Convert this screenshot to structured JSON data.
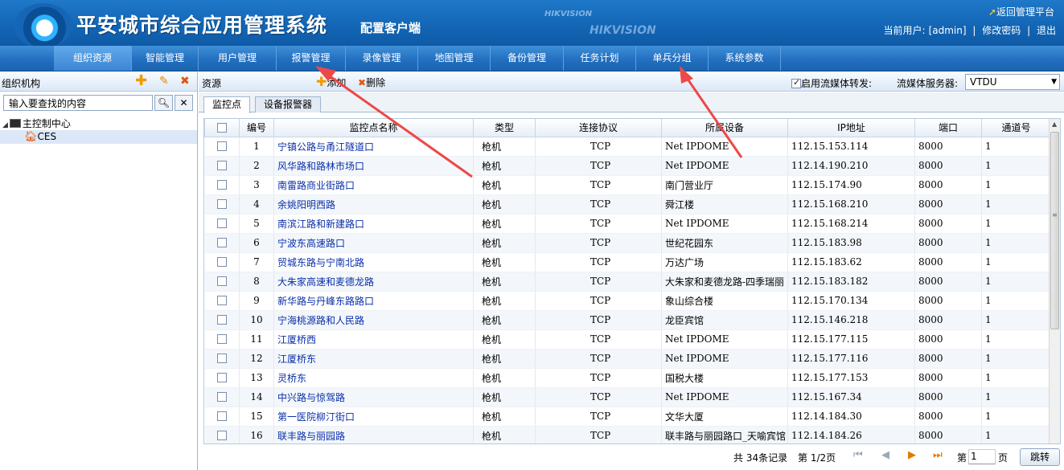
{
  "header": {
    "title": "平安城市综合应用管理系统",
    "subtitle": "配置客户端",
    "brand_small": "HIKVISION",
    "brand_large": "HIKVISION",
    "return_link": "返回管理平台",
    "user_label": "当前用户:",
    "user_name": "[admin]",
    "sep": "|",
    "change_password": "修改密码",
    "logout": "退出"
  },
  "nav": {
    "items": [
      {
        "label": "组织资源"
      },
      {
        "label": "智能管理"
      },
      {
        "label": "用户管理"
      },
      {
        "label": "报警管理"
      },
      {
        "label": "录像管理"
      },
      {
        "label": "地图管理"
      },
      {
        "label": "备份管理"
      },
      {
        "label": "任务计划"
      },
      {
        "label": "单兵分组"
      },
      {
        "label": "系统参数"
      }
    ]
  },
  "left": {
    "title": "组织机构",
    "search_placeholder": "输入要查找的内容",
    "tree": {
      "root": "主控制中心",
      "child": "CES"
    }
  },
  "resources": {
    "title": "资源",
    "add_label": "添加",
    "delete_label": "删除",
    "forward_label": "启用流媒体转发:",
    "server_label": "流媒体服务器:",
    "server_value": "VTDU",
    "tabs": [
      "监控点",
      "设备报警器"
    ]
  },
  "table": {
    "columns": [
      "编号",
      "监控点名称",
      "类型",
      "连接协议",
      "所属设备",
      "IP地址",
      "端口",
      "通道号"
    ],
    "rows": [
      [
        "1",
        "宁镇公路与甬江隧道口",
        "枪机",
        "TCP",
        "Net IPDOME",
        "112.15.153.114",
        "8000",
        "1"
      ],
      [
        "2",
        "风华路和路林市场口",
        "枪机",
        "TCP",
        "Net IPDOME",
        "112.14.190.210",
        "8000",
        "1"
      ],
      [
        "3",
        "南雷路商业街路口",
        "枪机",
        "TCP",
        "南门营业厅",
        "112.15.174.90",
        "8000",
        "1"
      ],
      [
        "4",
        "余姚阳明西路",
        "枪机",
        "TCP",
        "舜江楼",
        "112.15.168.210",
        "8000",
        "1"
      ],
      [
        "5",
        "南滨江路和新建路口",
        "枪机",
        "TCP",
        "Net IPDOME",
        "112.15.168.214",
        "8000",
        "1"
      ],
      [
        "6",
        "宁波东高速路口",
        "枪机",
        "TCP",
        "世纪花园东",
        "112.15.183.98",
        "8000",
        "1"
      ],
      [
        "7",
        "贸城东路与宁南北路",
        "枪机",
        "TCP",
        "万达广场",
        "112.15.183.62",
        "8000",
        "1"
      ],
      [
        "8",
        "大朱家高速和麦德龙路",
        "枪机",
        "TCP",
        "大朱家和麦德龙路-四季瑞丽",
        "112.15.183.182",
        "8000",
        "1"
      ],
      [
        "9",
        "新华路与丹峰东路路口",
        "枪机",
        "TCP",
        "象山综合楼",
        "112.15.170.134",
        "8000",
        "1"
      ],
      [
        "10",
        "宁海桃源路和人民路",
        "枪机",
        "TCP",
        "龙臣宾馆",
        "112.15.146.218",
        "8000",
        "1"
      ],
      [
        "11",
        "江厦桥西",
        "枪机",
        "TCP",
        "Net IPDOME",
        "112.15.177.115",
        "8000",
        "1"
      ],
      [
        "12",
        "江厦桥东",
        "枪机",
        "TCP",
        "Net IPDOME",
        "112.15.177.116",
        "8000",
        "1"
      ],
      [
        "13",
        "灵桥东",
        "枪机",
        "TCP",
        "国税大楼",
        "112.15.177.153",
        "8000",
        "1"
      ],
      [
        "14",
        "中兴路与惊驾路",
        "枪机",
        "TCP",
        "Net IPDOME",
        "112.15.167.34",
        "8000",
        "1"
      ],
      [
        "15",
        "第一医院柳汀街口",
        "枪机",
        "TCP",
        "文华大厦",
        "112.14.184.30",
        "8000",
        "1"
      ],
      [
        "16",
        "联丰路与丽园路",
        "枪机",
        "TCP",
        "联丰路与丽园路口_天喻宾馆",
        "112.14.184.26",
        "8000",
        "1"
      ]
    ]
  },
  "pager": {
    "total": "共 34条记录",
    "page_info": "第 1/2页",
    "goto_label": "第",
    "goto_value": "1",
    "page_suffix": "页",
    "jump": "跳转"
  },
  "colors": {
    "header_bg": "#1265b4",
    "nav_bg": "#2370c1",
    "link_text": "#0a2fa8",
    "arrow": "#ef4a4a"
  }
}
